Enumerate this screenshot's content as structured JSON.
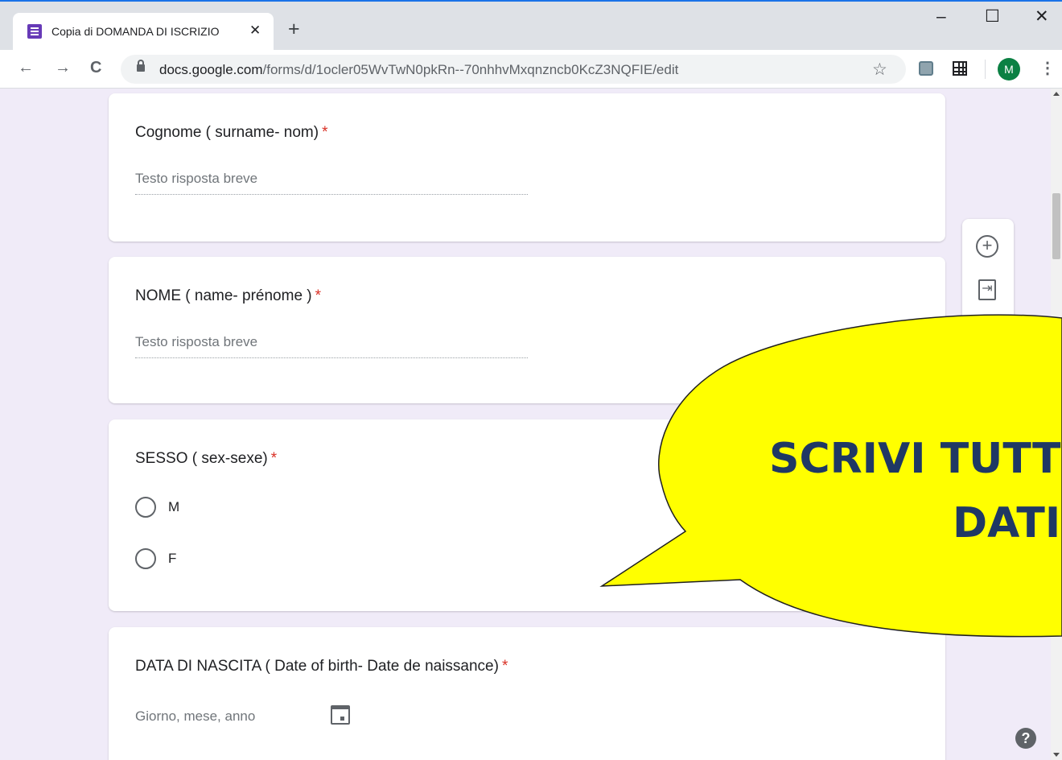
{
  "browser": {
    "tab_title": "Copia di DOMANDA DI ISCRIZIO",
    "tab_close": "✕",
    "new_tab": "+",
    "window": {
      "minimize": "–",
      "maximize": "☐",
      "close": "✕"
    },
    "nav": {
      "back": "←",
      "forward": "→",
      "reload": "C"
    },
    "url_host": "docs.google.com",
    "url_path": "/forms/d/1ocler05WvTwN0pkRn--70nhhvMxqnzncb0KcZ3NQFIE/edit",
    "bookmark_star": "☆",
    "avatar_letter": "M",
    "menu": "⋮"
  },
  "form": {
    "questions": [
      {
        "title": "Cognome ( surname- nom)",
        "required": "*",
        "placeholder": "Testo risposta breve"
      },
      {
        "title": "NOME ( name-  prénome )",
        "required": "*",
        "placeholder": "Testo risposta breve"
      },
      {
        "title": "SESSO ( sex-sexe)",
        "required": "*",
        "options": [
          "M",
          "F"
        ]
      },
      {
        "title": "DATA DI NASCITA ( Date of birth- Date de naissance)",
        "required": "*",
        "placeholder": "Giorno, mese, anno"
      }
    ]
  },
  "side_toolbar": {
    "add": "+",
    "import": "⇥"
  },
  "help": "?",
  "callout": {
    "line1": "SCRIVI TUTT",
    "line2": "DATI",
    "fill": "#ffff00",
    "text_color": "#1f3864"
  }
}
